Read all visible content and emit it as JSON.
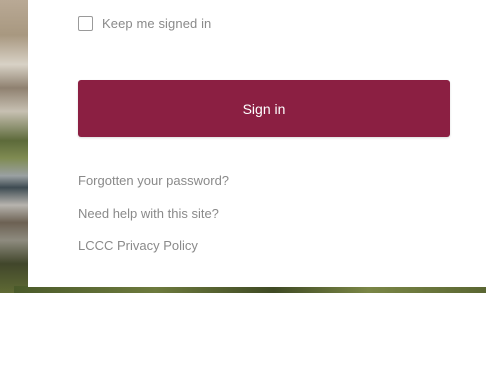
{
  "login_form": {
    "remember_me_label": "Keep me signed in",
    "remember_me_checked": false,
    "sign_in_button_label": "Sign in",
    "links": [
      "Forgotten your password?",
      "Need help with this site?",
      "LCCC Privacy Policy"
    ]
  },
  "colors": {
    "accent": "#8b1f42",
    "link_text": "#8a8a8a",
    "background": "#ffffff"
  }
}
